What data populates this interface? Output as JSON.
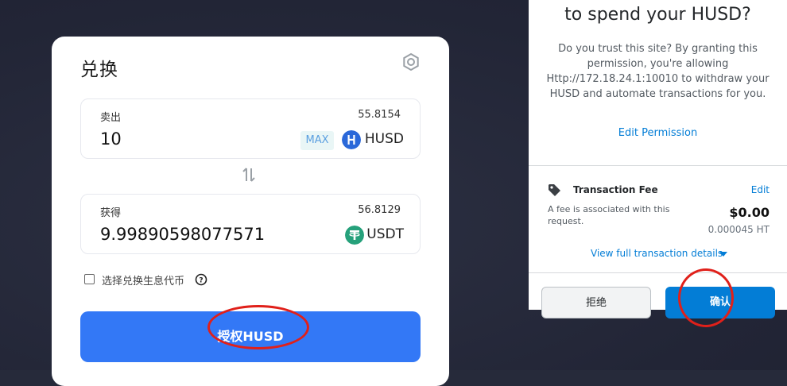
{
  "swap": {
    "title": "兑换",
    "sell": {
      "label": "卖出",
      "balance": "55.8154",
      "amount": "10",
      "max_label": "MAX",
      "token": "HUSD"
    },
    "receive": {
      "label": "获得",
      "balance": "56.8129",
      "amount": "9.99890598077571",
      "token": "USDT"
    },
    "checkbox_label": "选择兑换生息代币",
    "authorize_label": "授权HUSD"
  },
  "approval": {
    "title": "to spend your HUSD?",
    "description": "Do you trust this site? By granting this permission, you're allowing Http://172.18.24.1:10010 to withdraw your HUSD and automate transactions for you.",
    "edit_permission": "Edit Permission",
    "fee": {
      "title": "Transaction Fee",
      "edit": "Edit",
      "description": "A fee is associated with this request.",
      "amount": "$0.00",
      "amount_ht": "0.000045 HT"
    },
    "view_details": "View full transaction details",
    "reject_label": "拒绝",
    "confirm_label": "确认"
  },
  "colors": {
    "accent_blue": "#3378f6",
    "metamask_blue": "#037dd6",
    "husd_blue": "#2a68d9",
    "usdt_green": "#26a17b",
    "annotation_red": "#e0201a"
  }
}
